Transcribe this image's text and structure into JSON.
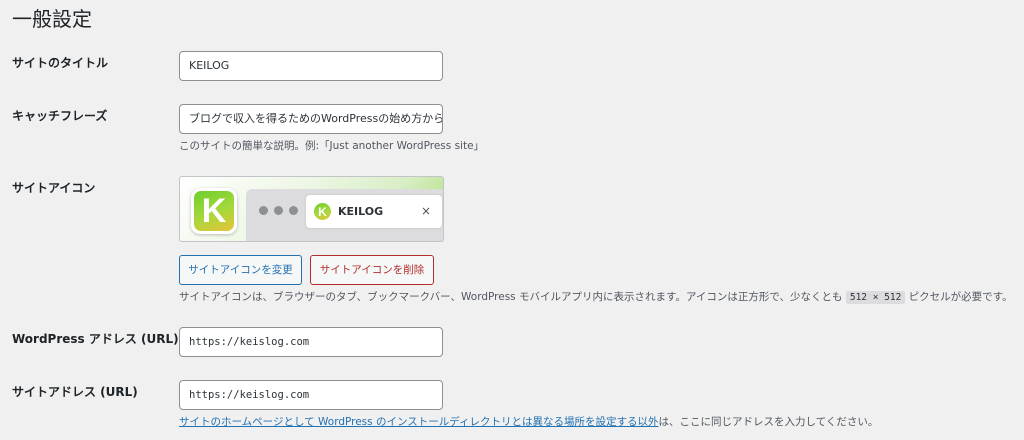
{
  "page_title": "一般設定",
  "fields": {
    "site_title": {
      "label": "サイトのタイトル",
      "value": "KEILOG"
    },
    "tagline": {
      "label": "キャッチフレーズ",
      "value": "ブログで収入を得るためのWordPressの始め方からブ",
      "description": "このサイトの簡単な説明。例:「Just another WordPress site」"
    },
    "site_icon": {
      "label": "サイトアイコン",
      "preview": {
        "app_icon": "keilog-k-logo",
        "tab_title": "KEILOG",
        "tab_close": "×",
        "favicon": "keilog-k-logo",
        "logo_letter": "K"
      },
      "change_button": "サイトアイコンを変更",
      "remove_button": "サイトアイコンを削除",
      "description_before": "サイトアイコンは、ブラウザーのタブ、ブックマークバー、WordPress モバイルアプリ内に表示されます。アイコンは正方形で、少なくとも",
      "description_size": "512 × 512",
      "description_after": "ピクセルが必要です。"
    },
    "wordpress_address": {
      "label": "WordPress アドレス (URL)",
      "value": "https://keislog.com"
    },
    "site_address": {
      "label": "サイトアドレス (URL)",
      "value": "https://keislog.com",
      "description_link": "サイトのホームページとして WordPress のインストールディレクトリとは異なる場所を設定する以外",
      "description_after": "は、ここに同じアドレスを入力してください。"
    }
  },
  "colors": {
    "background": "#f0f0f1",
    "link": "#2271b1",
    "danger": "#b32d2e",
    "text": "#1d2327",
    "muted": "#50575e",
    "brand_green": "#6fcf2f",
    "brand_yellow": "#e8c33a"
  }
}
